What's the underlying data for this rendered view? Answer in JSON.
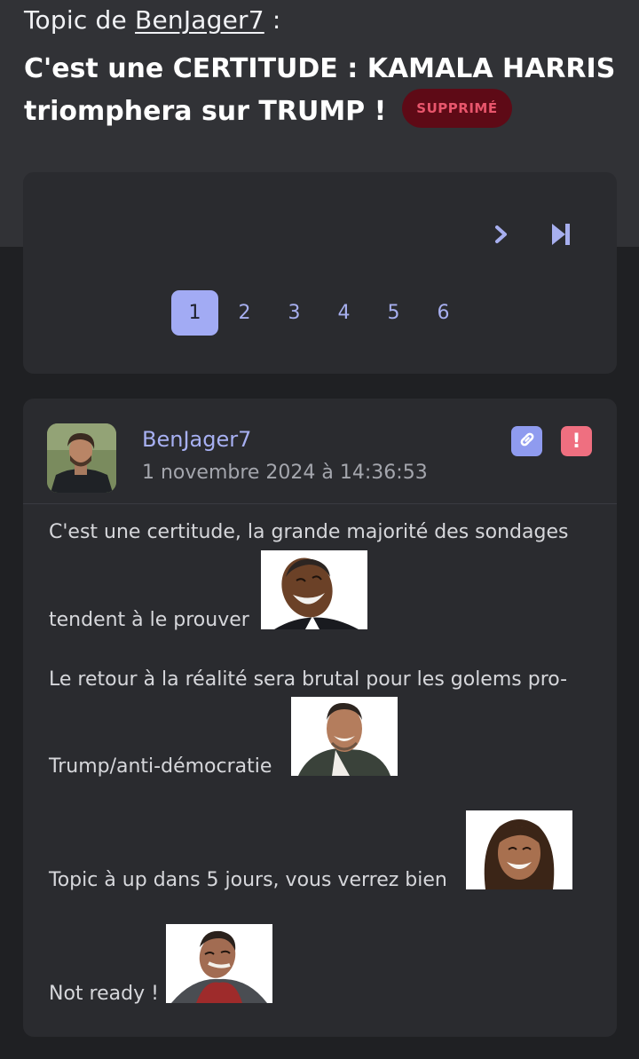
{
  "topic": {
    "prefix": "Topic de",
    "author": "BenJager7",
    "suffix": ":",
    "title": "C'est une CERTITUDE : KAMALA HARRIS triomphera sur TRUMP !",
    "badge": "SUPPRIMÉ"
  },
  "pagination": {
    "next_icon": "chevron-right-icon",
    "last_icon": "skip-to-end-icon",
    "pages": [
      "1",
      "2",
      "3",
      "4",
      "5",
      "6"
    ],
    "current": "1"
  },
  "post": {
    "author": "BenJager7",
    "date": "1 novembre 2024 à 14:36:53",
    "permalink_icon": "link-icon",
    "report_icon": "exclamation-icon",
    "report_glyph": "!",
    "lines": [
      "C'est une certitude, la grande majorité des sondages",
      "tendent à le prouver",
      "Le retour à la réalité sera brutal pour les golems pro-",
      "Trump/anti-démocratie",
      "Topic à up dans 5 jours, vous verrez bien",
      "Not ready !"
    ],
    "stickers": [
      "laughing-man-sticker",
      "grinning-man-sticker",
      "smiling-woman-sticker",
      "grimacing-man-sticker"
    ]
  },
  "colors": {
    "background": "#1f2023",
    "header_background": "#313236",
    "card_background": "#2a2b2f",
    "accent": "#a2abf4",
    "deleted_badge_bg": "#5e0a16",
    "deleted_badge_text": "#e9566c",
    "report": "#ef6f80"
  }
}
